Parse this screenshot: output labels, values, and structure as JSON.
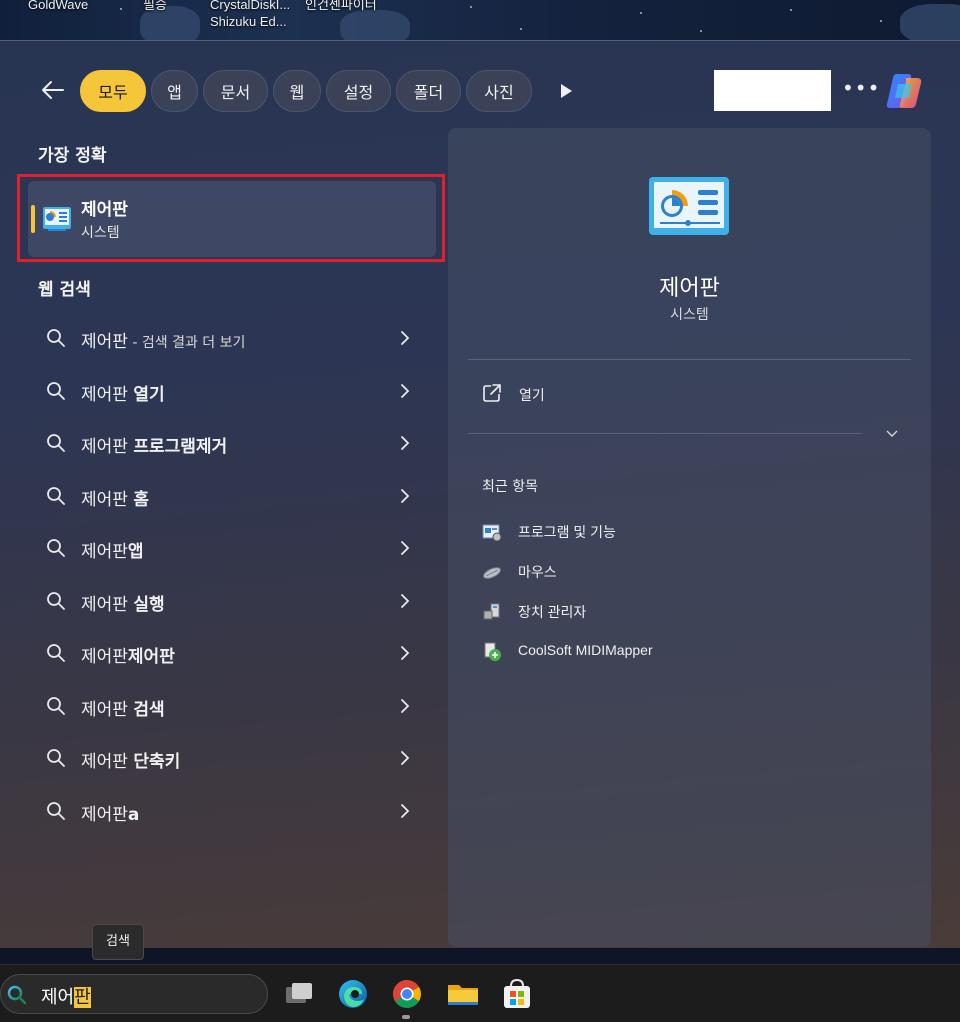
{
  "desktop": {
    "icons": [
      "GoldWave",
      "필승",
      "CrystalDiskI...",
      "Shizuku Ed...",
      "인건센파이터"
    ]
  },
  "filters": {
    "tabs": [
      {
        "label": "모두",
        "active": true
      },
      {
        "label": "앱",
        "active": false
      },
      {
        "label": "문서",
        "active": false
      },
      {
        "label": "웹",
        "active": false
      },
      {
        "label": "설정",
        "active": false
      },
      {
        "label": "폴더",
        "active": false
      },
      {
        "label": "사진",
        "active": false
      }
    ]
  },
  "best_match": {
    "section_title": "가장 정확",
    "name": "제어판",
    "subtitle": "시스템"
  },
  "web_search": {
    "section_title": "웹 검색",
    "results": [
      {
        "prefix": "제어판",
        "suffix": "",
        "small": " - 검색 결과 더 보기"
      },
      {
        "prefix": "제어판 ",
        "suffix": "열기",
        "small": ""
      },
      {
        "prefix": "제어판 ",
        "suffix": "프로그램제거",
        "small": ""
      },
      {
        "prefix": "제어판 ",
        "suffix": "홈",
        "small": ""
      },
      {
        "prefix": "제어판",
        "suffix": "앱",
        "small": ""
      },
      {
        "prefix": "제어판 ",
        "suffix": "실행",
        "small": ""
      },
      {
        "prefix": "제어판",
        "suffix": "제어판",
        "small": ""
      },
      {
        "prefix": "제어판 ",
        "suffix": "검색",
        "small": ""
      },
      {
        "prefix": "제어판 ",
        "suffix": "단축키",
        "small": ""
      },
      {
        "prefix": "제어판",
        "suffix": "a",
        "small": ""
      }
    ]
  },
  "preview": {
    "name": "제어판",
    "subtitle": "시스템",
    "open_label": "열기",
    "recent_title": "최근 항목",
    "recent_items": [
      {
        "label": "프로그램 및 기능",
        "icon": "programs-features-icon"
      },
      {
        "label": "마우스",
        "icon": "mouse-icon"
      },
      {
        "label": "장치 관리자",
        "icon": "device-manager-icon"
      },
      {
        "label": "CoolSoft MIDIMapper",
        "icon": "midimapper-icon"
      }
    ]
  },
  "tooltip": {
    "text": "검색"
  },
  "taskbar": {
    "search_text": "제어",
    "search_caret_text": "판",
    "apps": [
      "task-view-icon",
      "edge-icon",
      "chrome-icon",
      "file-explorer-icon",
      "store-icon"
    ]
  },
  "colors": {
    "accent": "#f5c53a",
    "highlight_border": "#e0202a"
  }
}
